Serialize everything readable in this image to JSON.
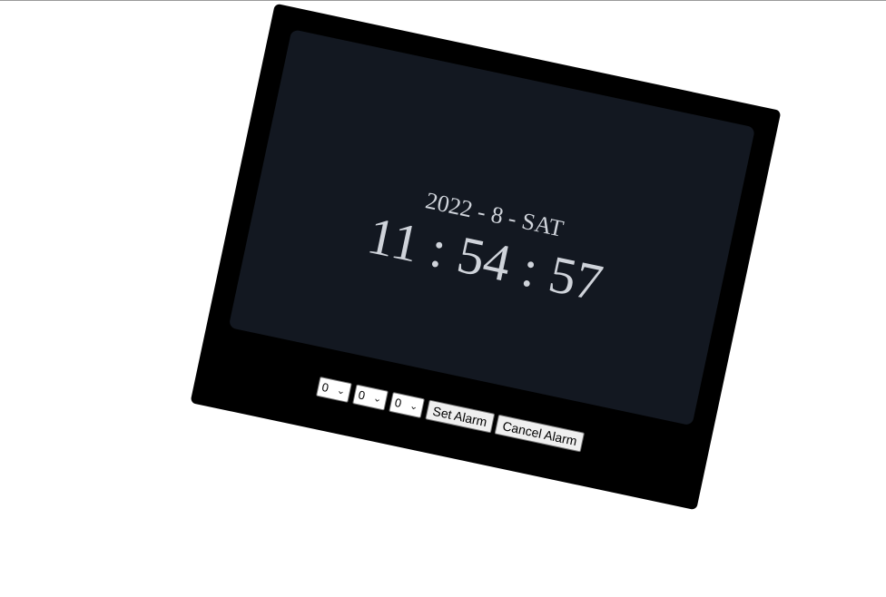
{
  "clock": {
    "date": "2022 - 8 - SAT",
    "time": "11 : 54 : 57"
  },
  "alarm": {
    "hour_value": "0",
    "minute_value": "0",
    "second_value": "0",
    "set_label": "Set Alarm",
    "cancel_label": "Cancel Alarm"
  },
  "colors": {
    "device": "#000000",
    "screen": "#131821",
    "text": "#cfd3da"
  },
  "icons": {
    "dropdown": "chevron-down-icon"
  }
}
